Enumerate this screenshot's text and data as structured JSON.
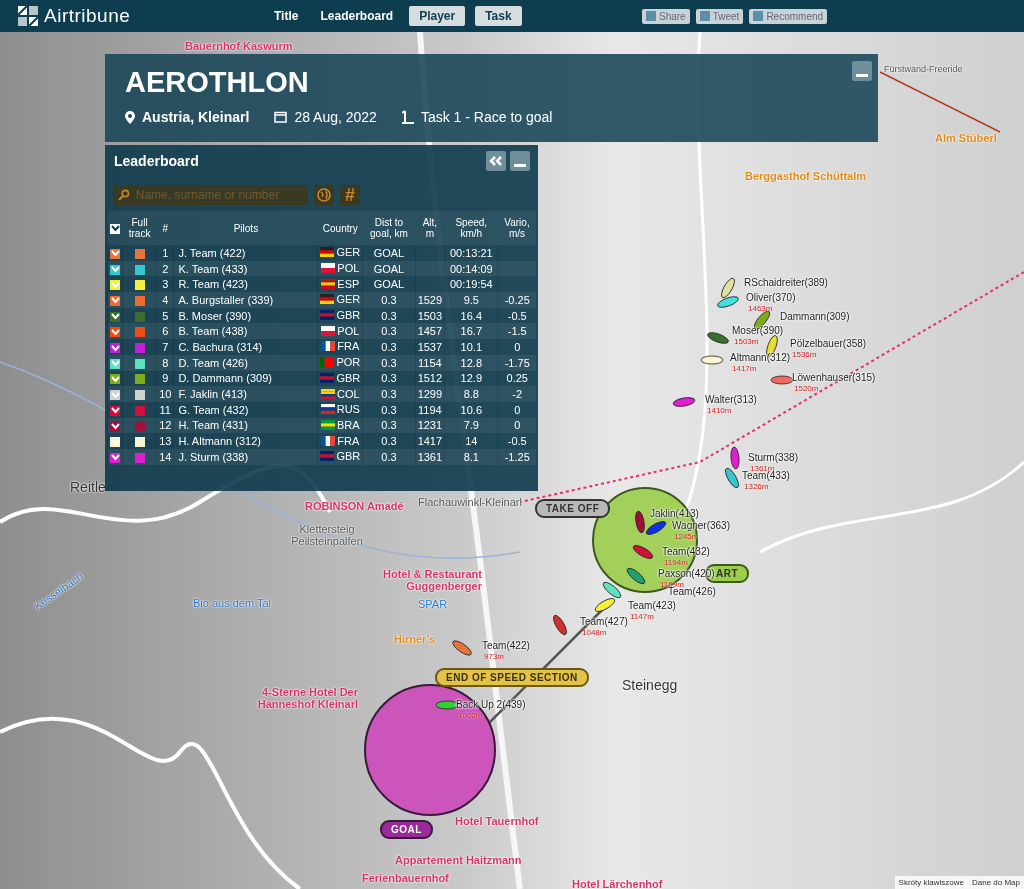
{
  "header": {
    "logo": "Airtribune",
    "nav": [
      {
        "label": "Title",
        "kind": "link"
      },
      {
        "label": "Leaderboard",
        "kind": "link"
      },
      {
        "label": "Player",
        "kind": "button"
      },
      {
        "label": "Task",
        "kind": "button"
      }
    ],
    "share": [
      "Share",
      "Tweet",
      "Recommend"
    ]
  },
  "event": {
    "title": "AEROTHLON",
    "location": "Austria, Kleinarl",
    "date": "28 Aug, 2022",
    "task": "Task 1 - Race to goal"
  },
  "leaderboard": {
    "title": "Leaderboard",
    "search": {
      "placeholder": "Name, surname or number"
    },
    "hash_button": "#",
    "columns": [
      "Full track",
      "#",
      "Pilots",
      "Country",
      "Dist to goal, km",
      "Alt, m",
      "Speed, km/h",
      "Vario, m/s"
    ],
    "all_checked": true,
    "rows": [
      {
        "checked": true,
        "color": "#e8743b",
        "rank": "1",
        "pilot": "J. Team (422)",
        "flag": {
          "kind": "horizontal",
          "stripes": [
            {
              "color": "#222222"
            },
            {
              "color": "#dd0000"
            },
            {
              "color": "#ffce00"
            }
          ]
        },
        "country": "GER",
        "dist": "GOAL",
        "alt": "",
        "speed": "00:13:21",
        "vario": ""
      },
      {
        "checked": true,
        "color": "#35c6d0",
        "rank": "2",
        "pilot": "K. Team (433)",
        "flag": {
          "kind": "horizontal",
          "stripes": [
            {
              "color": "#ffffff"
            },
            {
              "color": "#dc143c"
            }
          ]
        },
        "country": "POL",
        "dist": "GOAL",
        "alt": "",
        "speed": "00:14:09",
        "vario": ""
      },
      {
        "checked": true,
        "color": "#f5f03a",
        "rank": "3",
        "pilot": "R. Team (423)",
        "flag": {
          "kind": "horizontal",
          "stripes": [
            {
              "color": "#c60b1e"
            },
            {
              "color": "#ffc400"
            },
            {
              "color": "#c60b1e"
            }
          ]
        },
        "country": "ESP",
        "dist": "GOAL",
        "alt": "",
        "speed": "00:19:54",
        "vario": ""
      },
      {
        "checked": true,
        "color": "#f06a30",
        "rank": "4",
        "pilot": "A. Burgstaller (339)",
        "flag": {
          "kind": "horizontal",
          "stripes": [
            {
              "color": "#222222"
            },
            {
              "color": "#dd0000"
            },
            {
              "color": "#ffce00"
            }
          ]
        },
        "country": "GER",
        "dist": "0.3",
        "alt": "1529",
        "speed": "9.5",
        "vario": "-0.25"
      },
      {
        "checked": true,
        "color": "#3a6e2e",
        "rank": "5",
        "pilot": "B. Moser (390)",
        "flag": {
          "kind": "horizontal",
          "stripes": [
            {
              "color": "#012169"
            },
            {
              "color": "#c8102e"
            },
            {
              "color": "#012169"
            }
          ]
        },
        "country": "GBR",
        "dist": "0.3",
        "alt": "1503",
        "speed": "16.4",
        "vario": "-0.5"
      },
      {
        "checked": true,
        "color": "#f24a10",
        "rank": "6",
        "pilot": "B. Team (438)",
        "flag": {
          "kind": "horizontal",
          "stripes": [
            {
              "color": "#ffffff"
            },
            {
              "color": "#dc143c"
            }
          ]
        },
        "country": "POL",
        "dist": "0.3",
        "alt": "1457",
        "speed": "16.7",
        "vario": "-1.5"
      },
      {
        "checked": true,
        "color": "#c51fd6",
        "rank": "7",
        "pilot": "C. Bachura (314)",
        "flag": {
          "kind": "vertical",
          "stripes": [
            {
              "color": "#0055a4"
            },
            {
              "color": "#ffffff"
            },
            {
              "color": "#ef4135"
            }
          ]
        },
        "country": "FRA",
        "dist": "0.3",
        "alt": "1537",
        "speed": "10.1",
        "vario": "0"
      },
      {
        "checked": true,
        "color": "#5fe0c0",
        "rank": "8",
        "pilot": "D. Team (426)",
        "flag": {
          "kind": "vertical",
          "stripes": [
            {
              "color": "#006600"
            },
            {
              "color": "#ff0000"
            },
            {
              "color": "#ff0000"
            }
          ]
        },
        "country": "POR",
        "dist": "0.3",
        "alt": "1154",
        "speed": "12.8",
        "vario": "-1.75"
      },
      {
        "checked": true,
        "color": "#7fad1a",
        "rank": "9",
        "pilot": "D. Dammann (309)",
        "flag": {
          "kind": "horizontal",
          "stripes": [
            {
              "color": "#012169"
            },
            {
              "color": "#c8102e"
            },
            {
              "color": "#012169"
            }
          ]
        },
        "country": "GBR",
        "dist": "0.3",
        "alt": "1512",
        "speed": "12.9",
        "vario": "0.25"
      },
      {
        "checked": true,
        "color": "#d0d0d0",
        "rank": "10",
        "pilot": "F. Jaklin (413)",
        "flag": {
          "kind": "horizontal",
          "stripes": [
            {
              "color": "#fcd116"
            },
            {
              "color": "#fcd116"
            },
            {
              "color": "#003893"
            },
            {
              "color": "#ce1126"
            }
          ]
        },
        "country": "COL",
        "dist": "0.3",
        "alt": "1299",
        "speed": "8.8",
        "vario": "-2"
      },
      {
        "checked": true,
        "color": "#d0103c",
        "rank": "11",
        "pilot": "G. Team (432)",
        "flag": {
          "kind": "horizontal",
          "stripes": [
            {
              "color": "#ffffff"
            },
            {
              "color": "#0039a6"
            },
            {
              "color": "#d52b1e"
            }
          ]
        },
        "country": "RUS",
        "dist": "0.3",
        "alt": "1194",
        "speed": "10.6",
        "vario": "0"
      },
      {
        "checked": true,
        "color": "#a0103a",
        "rank": "12",
        "pilot": "H. Team (431)",
        "flag": {
          "kind": "horizontal",
          "stripes": [
            {
              "color": "#009c3b"
            },
            {
              "color": "#ffdf00"
            },
            {
              "color": "#009c3b"
            }
          ]
        },
        "country": "BRA",
        "dist": "0.3",
        "alt": "1231",
        "speed": "7.9",
        "vario": "0"
      },
      {
        "checked": true,
        "color": "#f8f5d0",
        "rank": "13",
        "pilot": "H. Altmann (312)",
        "flag": {
          "kind": "vertical",
          "stripes": [
            {
              "color": "#0055a4"
            },
            {
              "color": "#ffffff"
            },
            {
              "color": "#ef4135"
            }
          ]
        },
        "country": "FRA",
        "dist": "0.3",
        "alt": "1417",
        "speed": "14",
        "vario": "-0.5"
      },
      {
        "checked": true,
        "color": "#e020d0",
        "rank": "14",
        "pilot": "J. Sturm (338)",
        "flag": {
          "kind": "horizontal",
          "stripes": [
            {
              "color": "#012169"
            },
            {
              "color": "#c8102e"
            },
            {
              "color": "#012169"
            }
          ]
        },
        "country": "GBR",
        "dist": "0.3",
        "alt": "1361",
        "speed": "8.1",
        "vario": "-1.25"
      }
    ]
  },
  "map": {
    "labels": [
      {
        "kind": "poi-pink",
        "text": "Bauernhof Kaswurm"
      },
      {
        "kind": "road",
        "text": "Fürstwand-Freeride"
      },
      {
        "kind": "poi-orange",
        "text": "Alm Stüberl"
      },
      {
        "kind": "poi-orange",
        "text": "Berggasthof Schüttalm"
      },
      {
        "kind": "place",
        "text": "Reitle"
      },
      {
        "kind": "poi-pink",
        "text": "ROBINSON Amadé"
      },
      {
        "kind": "poi-grey",
        "text": "Klettersteig Peilsteinpalfen"
      },
      {
        "kind": "poi-pink",
        "text": "Hotel & Restaurant Guggenberger"
      },
      {
        "kind": "poi-blue",
        "text": "Bio aus dem Tal"
      },
      {
        "kind": "poi-blue",
        "text": "SPAR"
      },
      {
        "kind": "poi-orange",
        "text": "Hirner's"
      },
      {
        "kind": "poi-pink",
        "text": "4-Sterne Hotel Der Hanneshof Kleinarl"
      },
      {
        "kind": "place",
        "text": "Steinegg"
      },
      {
        "kind": "poi-pink",
        "text": "Hotel Tauernhof"
      },
      {
        "kind": "poi-pink",
        "text": "Appartement Haitzmann"
      },
      {
        "kind": "poi-pink",
        "text": "Ferienbauernhof"
      },
      {
        "kind": "poi-pink",
        "text": "Hotel Lärchenhof"
      },
      {
        "kind": "poi-grey",
        "text": "Flachauwinkl-Kleinarl"
      },
      {
        "kind": "water",
        "text": "Kesselbach"
      }
    ],
    "turnpoints": [
      {
        "kind": "takeoff",
        "label": "TAKE OFF"
      },
      {
        "kind": "start",
        "label": "ART"
      },
      {
        "kind": "ess",
        "label": "END OF SPEED SECTION"
      },
      {
        "kind": "goal",
        "label": "GOAL"
      }
    ],
    "pilots": [
      {
        "name": "RSchaidreiter(389)",
        "color": "#e0e0a0"
      },
      {
        "name": "Oliver(370)",
        "altitude": "1463m",
        "color": "#40e0e0"
      },
      {
        "name": "Dammann(309)",
        "color": "#7fad1a"
      },
      {
        "name": "Moser(390)",
        "altitude": "1503m",
        "color": "#3a6e2e"
      },
      {
        "name": "Pölzelbauer(358)",
        "altitude": "1536m",
        "color": "#e8e030"
      },
      {
        "name": "Altmann(312)",
        "altitude": "1417m",
        "color": "#f8f5d0"
      },
      {
        "name": "Löwenhauser(315)",
        "altitude": "1520m",
        "color": "#f06a60"
      },
      {
        "name": "Walter(313)",
        "altitude": "1410m",
        "color": "#e020d0"
      },
      {
        "name": "Sturm(338)",
        "altitude": "1361m",
        "color": "#e020d0"
      },
      {
        "name": "Team(433)",
        "altitude": "1326m",
        "color": "#35c6d0"
      },
      {
        "name": "Jaklin(413)",
        "color": "#a0103a"
      },
      {
        "name": "Wagner(363)",
        "altitude": "1245m",
        "color": "#1030e0"
      },
      {
        "name": "Team(432)",
        "altitude": "1194m",
        "color": "#d0103c"
      },
      {
        "name": "Paxson(420)",
        "altitude": "1169m",
        "color": "#20a070"
      },
      {
        "name": "Team(426)",
        "color": "#5fe0c0"
      },
      {
        "name": "Team(423)",
        "altitude": "1147m",
        "color": "#f5f03a"
      },
      {
        "name": "Team(427)",
        "altitude": "1048m",
        "color": "#d03030"
      },
      {
        "name": "Team(422)",
        "altitude": "973m",
        "color": "#e8743b"
      },
      {
        "name": "Back Up 2(439)",
        "altitude": "1002m",
        "color": "#30d030"
      }
    ],
    "attribution": [
      "Skróty klawiszowe",
      "Dane do Map"
    ]
  }
}
